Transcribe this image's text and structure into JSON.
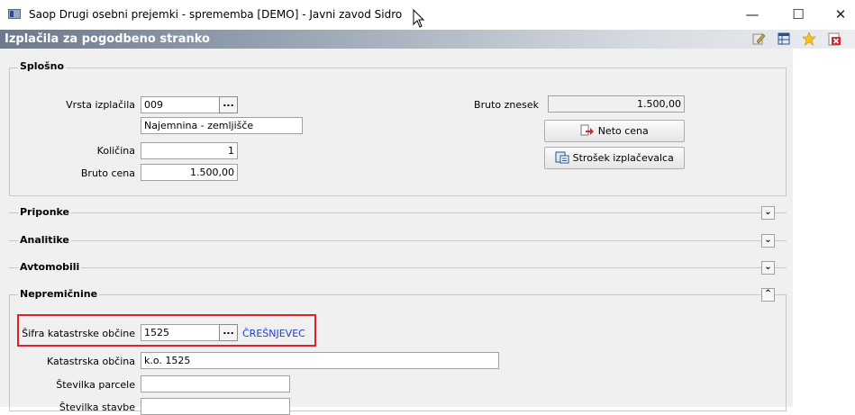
{
  "window": {
    "title": "Saop Drugi osebni prejemki - sprememba [DEMO] - Javni zavod Sidro",
    "minimize_glyph": "—",
    "maximize_glyph": "☐",
    "close_glyph": "✕"
  },
  "header": {
    "title": "Izplačila za pogodbeno stranko",
    "tool_icons": [
      "edit-icon",
      "table-icon",
      "favorite-star-icon",
      "close-document-icon"
    ]
  },
  "splosno": {
    "label": "Splošno",
    "vrsta_izplacila_label": "Vrsta izplačila",
    "vrsta_izplacila_value": "009",
    "vrsta_izplacila_desc": "Najemnina - zemljišče",
    "kolicina_label": "Količina",
    "kolicina_value": "1",
    "bruto_cena_label": "Bruto cena",
    "bruto_cena_value": "1.500,00",
    "bruto_znesek_label": "Bruto znesek",
    "bruto_znesek_value": "1.500,00",
    "neto_cena_button": "Neto cena",
    "strosek_button": "Strošek izplačevalca",
    "lookup_glyph": "..."
  },
  "sections": {
    "priponke": "Priponke",
    "analitike": "Analitike",
    "avtomobili": "Avtomobili",
    "nepremicnine": "Nepremičnine",
    "expand_glyph": "⌄",
    "collapse_glyph": "⌃"
  },
  "nepremicnine": {
    "sifra_label": "Šifra katastrske občine",
    "sifra_value": "1525",
    "sifra_name": "ČREŠNJEVEC",
    "katastrska_label": "Katastrska občina",
    "katastrska_value": "k.o. 1525",
    "parcela_label": "Številka parcele",
    "parcela_value": "",
    "stavba_label": "Številka stavbe",
    "stavba_value": ""
  }
}
